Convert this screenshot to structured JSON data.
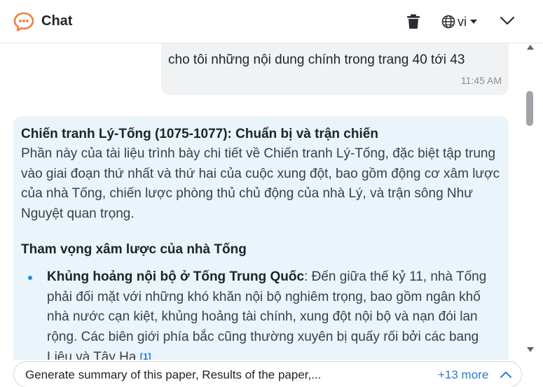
{
  "header": {
    "title": "Chat",
    "language": "vi",
    "icons": [
      "chat-bubble-icon",
      "trash-icon",
      "globe-icon",
      "caret-down-icon",
      "chevron-down-icon"
    ]
  },
  "messages": {
    "user": {
      "text": "cho tôi những nội dung chính trong trang 40 tới 43",
      "time": "11:45 AM"
    },
    "assistant": {
      "heading": "Chiến tranh Lý-Tống (1075-1077): Chuẩn bị và trận chiến",
      "intro": "Phần này của tài liệu trình bày chi tiết về Chiến tranh Lý-Tống, đặc biệt tập trung vào giai đoạn thứ nhất và thứ hai của cuộc xung đột, bao gồm động cơ xâm lược của nhà Tống, chiến lược phòng thủ chủ động của nhà Lý, và trận sông Như Nguyệt quan trọng.",
      "subheading": "Tham vọng xâm lược của nhà Tống",
      "bullets": [
        {
          "title": "Khủng hoảng nội bộ ở Tống Trung Quốc",
          "text": ": Đến giữa thế kỷ 11, nhà Tống phải đối mặt với những khó khăn nội bộ nghiêm trọng, bao gồm ngân khố nhà nước cạn kiệt, khủng hoảng tài chính, xung đột nội bộ và nạn đói lan rộng. Các biên giới phía bắc cũng thường xuyên bị quấy rối bởi các bang Liêu và Tây Hạ",
          "citation": "[1]"
        }
      ]
    }
  },
  "suggestions": {
    "text": "Generate summary of this paper, Results of the paper,...",
    "more": "+13 more"
  },
  "colors": {
    "accent": "#f0803c",
    "link": "#2b7bd1",
    "assistant_bg": "#eaf4fb",
    "user_bg": "#f0f2f3"
  }
}
